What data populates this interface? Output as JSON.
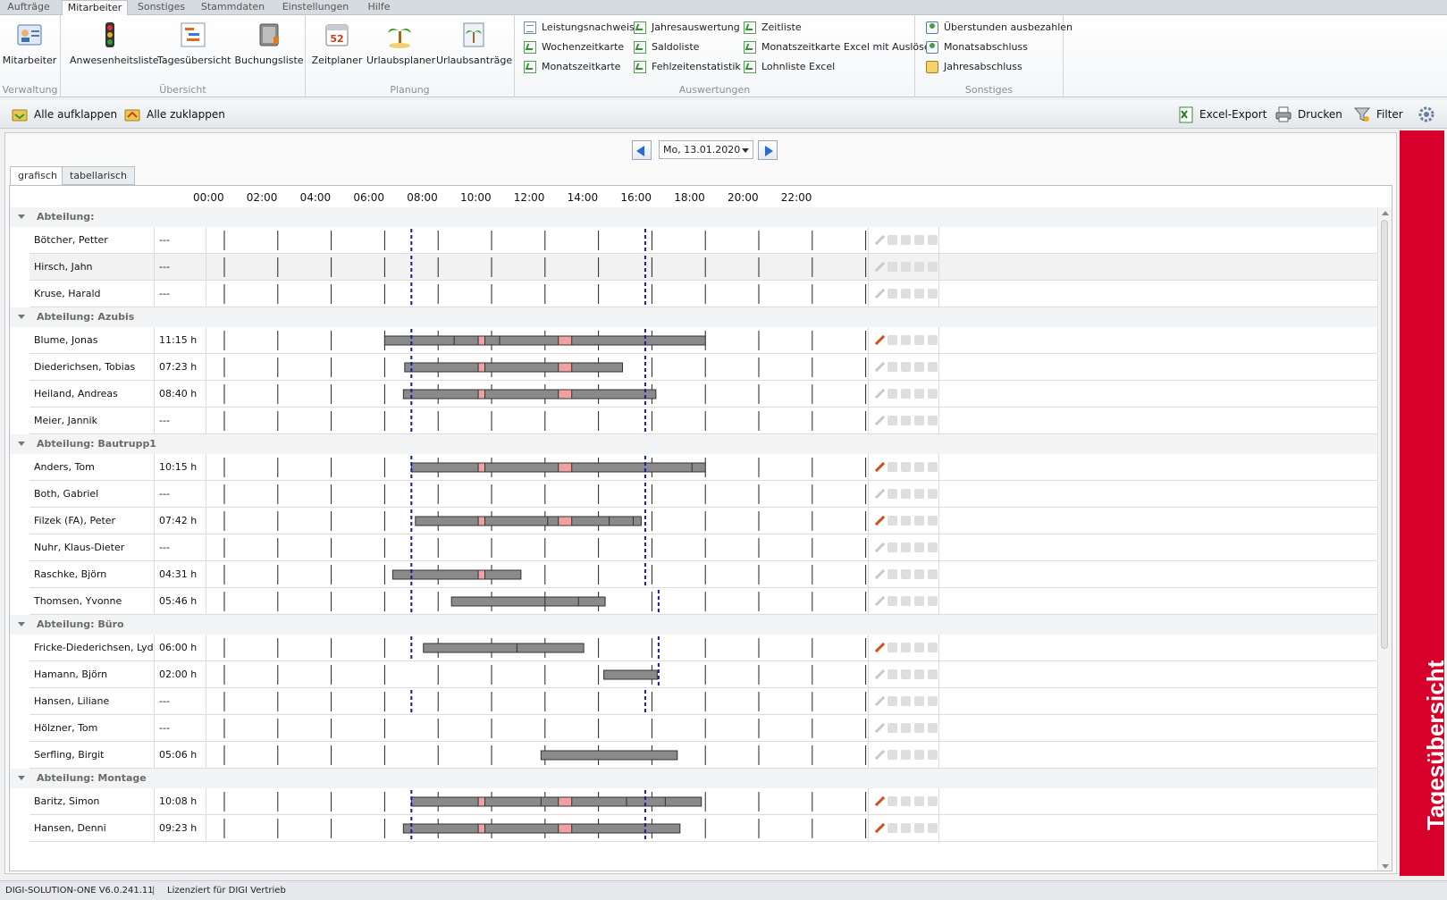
{
  "menu": {
    "tabs": [
      "Aufträge",
      "Mitarbeiter",
      "Sonstiges",
      "Stammdaten",
      "Einstellungen",
      "Hilfe"
    ],
    "active_index": 1
  },
  "ribbon": {
    "groups": {
      "verwaltung": {
        "label": "Verwaltung",
        "buttons": [
          "Mitarbeiter"
        ]
      },
      "uebersicht": {
        "label": "Übersicht",
        "buttons": [
          "Anwesenheitsliste",
          "Tagesübersicht",
          "Buchungsliste"
        ]
      },
      "planung": {
        "label": "Planung",
        "buttons": [
          "Zeitplaner",
          "Urlaubsplaner",
          "Urlaubsanträge"
        ]
      },
      "auswertungen": {
        "label": "Auswertungen",
        "items": [
          [
            "Leistungsnachweis",
            "Jahresauswertung",
            "Zeitliste"
          ],
          [
            "Wochenzeitkarte",
            "Saldoliste",
            "Monatszeitkarte Excel mit Auslöse"
          ],
          [
            "Monatszeitkarte",
            "Fehlzeitenstatistik",
            "Lohnliste Excel"
          ]
        ]
      },
      "sonstiges": {
        "label": "Sonstiges",
        "items": [
          "Überstunden ausbezahlen",
          "Monatsabschluss",
          "Jahresabschluss"
        ]
      }
    },
    "calendar_icon_text": "52"
  },
  "toolbar": {
    "expand_all": "Alle aufklappen",
    "collapse_all": "Alle zuklappen",
    "excel_export": "Excel-Export",
    "print": "Drucken",
    "filter": "Filter"
  },
  "date": {
    "value": "Mo, 13.01.2020"
  },
  "view_tabs": [
    "grafisch",
    "tabellarisch"
  ],
  "active_view": 0,
  "timeline": {
    "hour_labels": [
      "00:00",
      "02:00",
      "04:00",
      "06:00",
      "08:00",
      "10:00",
      "12:00",
      "14:00",
      "16:00",
      "18:00",
      "20:00",
      "22:00"
    ],
    "hours_min": 0,
    "hours_max": 24,
    "planned_start_default": 7.0,
    "planned_end_default": 15.75
  },
  "groups": [
    {
      "label": "Abteilung:",
      "employees": [
        {
          "name": "Bötcher, Petter",
          "hours": "---",
          "bars": [],
          "breaks": [],
          "ticks": [],
          "plan": [
            7.0,
            15.75
          ],
          "edit": false
        },
        {
          "name": "Hirsch, Jahn",
          "hours": "---",
          "bars": [],
          "breaks": [],
          "ticks": [],
          "plan": [
            7.0,
            15.75
          ],
          "edit": false,
          "selected": true
        },
        {
          "name": "Kruse, Harald",
          "hours": "---",
          "bars": [],
          "breaks": [],
          "ticks": [],
          "plan": [
            7.0,
            15.75
          ],
          "edit": false
        }
      ]
    },
    {
      "label": "Abteilung: Azubis",
      "employees": [
        {
          "name": "Blume, Jonas",
          "hours": "11:15 h",
          "bars": [
            [
              6.0,
              18.0
            ]
          ],
          "breaks": [
            [
              9.5,
              9.75
            ],
            [
              12.5,
              13.0
            ]
          ],
          "ticks": [
            8.6,
            10.3
          ],
          "plan": [
            7.0,
            15.75
          ],
          "edit": true
        },
        {
          "name": "Diederichsen, Tobias",
          "hours": "07:23 h",
          "bars": [
            [
              6.75,
              14.9
            ]
          ],
          "breaks": [
            [
              9.5,
              9.75
            ],
            [
              12.5,
              13.0
            ]
          ],
          "ticks": [],
          "plan": [
            7.0,
            15.75
          ],
          "edit": false
        },
        {
          "name": "Heiland, Andreas",
          "hours": "08:40 h",
          "bars": [
            [
              6.7,
              16.15
            ]
          ],
          "breaks": [
            [
              9.5,
              9.75
            ],
            [
              12.5,
              13.0
            ]
          ],
          "ticks": [],
          "plan": [
            7.0,
            15.75
          ],
          "edit": false
        },
        {
          "name": "Meier, Jannik",
          "hours": "---",
          "bars": [],
          "breaks": [],
          "ticks": [],
          "plan": [
            7.0,
            15.75
          ],
          "edit": false
        }
      ]
    },
    {
      "label": "Abteilung: Bautrupp1",
      "employees": [
        {
          "name": "Anders, Tom",
          "hours": "10:15 h",
          "bars": [
            [
              7.0,
              18.0
            ]
          ],
          "breaks": [
            [
              9.5,
              9.75
            ],
            [
              12.5,
              13.0
            ]
          ],
          "ticks": [
            17.5
          ],
          "plan": [
            7.0,
            15.75
          ],
          "edit": true
        },
        {
          "name": "Both, Gabriel",
          "hours": "---",
          "bars": [],
          "breaks": [],
          "ticks": [],
          "plan": [
            7.0,
            15.75
          ],
          "edit": false
        },
        {
          "name": "Filzek (FA), Peter",
          "hours": "07:42 h",
          "bars": [
            [
              7.15,
              15.6
            ]
          ],
          "breaks": [
            [
              9.5,
              9.75
            ],
            [
              12.5,
              13.0
            ]
          ],
          "ticks": [
            12.1,
            14.4,
            15.3
          ],
          "plan": [
            7.0,
            15.75
          ],
          "edit": true
        },
        {
          "name": "Nuhr, Klaus-Dieter",
          "hours": "---",
          "bars": [],
          "breaks": [],
          "ticks": [],
          "plan": [
            7.0,
            15.75
          ],
          "edit": false
        },
        {
          "name": "Raschke, Björn",
          "hours": "04:31 h",
          "bars": [
            [
              6.3,
              11.1
            ]
          ],
          "breaks": [
            [
              9.5,
              9.75
            ]
          ],
          "ticks": [],
          "plan": [
            7.0,
            15.75
          ],
          "edit": false
        },
        {
          "name": "Thomsen, Yvonne",
          "hours": "05:46 h",
          "bars": [
            [
              8.5,
              14.25
            ]
          ],
          "breaks": [],
          "ticks": [
            12.0,
            13.25
          ],
          "plan": [
            7.0,
            16.25
          ],
          "edit": false
        }
      ]
    },
    {
      "label": "Abteilung: Büro",
      "employees": [
        {
          "name": "Fricke-Diederichsen, Lydia",
          "hours": "06:00 h",
          "bars": [
            [
              7.45,
              13.45
            ]
          ],
          "breaks": [],
          "ticks": [
            10.95
          ],
          "plan": [
            7.0,
            16.25
          ],
          "edit": true
        },
        {
          "name": "Hamann, Björn",
          "hours": "02:00 h",
          "bars": [
            [
              14.2,
              16.2
            ]
          ],
          "breaks": [],
          "ticks": [],
          "plan": [
            null,
            16.25
          ],
          "edit": false
        },
        {
          "name": "Hansen, Liliane",
          "hours": "---",
          "bars": [],
          "breaks": [],
          "ticks": [],
          "plan": [
            7.0,
            15.75
          ],
          "edit": false
        },
        {
          "name": "Hölzner, Tom",
          "hours": "---",
          "bars": [],
          "breaks": [],
          "ticks": [],
          "plan": [],
          "edit": false
        },
        {
          "name": "Serfling, Birgit",
          "hours": "05:06 h",
          "bars": [
            [
              11.85,
              16.95
            ]
          ],
          "breaks": [],
          "ticks": [],
          "plan": [],
          "edit": false
        }
      ]
    },
    {
      "label": "Abteilung: Montage",
      "employees": [
        {
          "name": "Baritz, Simon",
          "hours": "10:08 h",
          "bars": [
            [
              7.0,
              17.85
            ]
          ],
          "breaks": [
            [
              9.5,
              9.75
            ],
            [
              12.5,
              13.0
            ]
          ],
          "ticks": [
            11.85,
            15.05,
            16.5
          ],
          "plan": [
            7.0,
            15.75
          ],
          "edit": true
        },
        {
          "name": "Hansen, Denni",
          "hours": "09:23 h",
          "bars": [
            [
              6.7,
              17.05
            ]
          ],
          "breaks": [
            [
              9.5,
              9.75
            ],
            [
              12.5,
              13.0
            ]
          ],
          "ticks": [],
          "plan": [
            7.0,
            15.75
          ],
          "edit": true
        }
      ]
    }
  ],
  "banner": {
    "title": "Tagesübersicht"
  },
  "status": {
    "version": "DIGI-SOLUTION-ONE V6.0.241.11",
    "license": "Lizenziert für DIGI Vertrieb"
  },
  "colors": {
    "bar_fill": "#8a8a8a",
    "break_fill": "#f0a0a0",
    "plan_line": "#1a1aa8",
    "banner": "#d6002a"
  }
}
